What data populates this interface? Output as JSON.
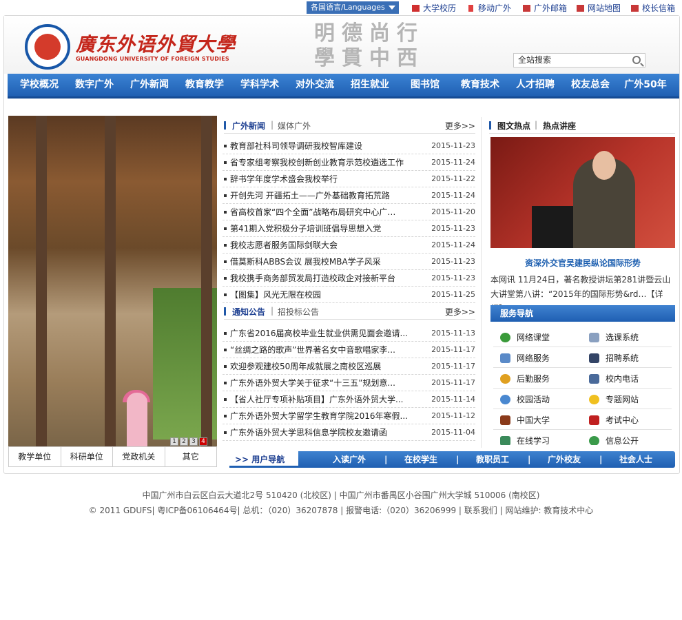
{
  "topbar": {
    "language": "各国语言/Languages",
    "links": [
      "大学校历",
      "移动广外",
      "广外邮箱",
      "网站地图",
      "校长信箱"
    ]
  },
  "header": {
    "cn_name": "廣东外语外貿大學",
    "en_name": "GUANGDONG UNIVERSITY OF FOREIGN STUDIES",
    "motto": "明德尚行 學貫中西",
    "search_value": "全站搜索"
  },
  "nav": [
    "学校概况",
    "数字广外",
    "广外新闻",
    "教育教学",
    "学科学术",
    "对外交流",
    "招生就业",
    "图书馆",
    "教育技术",
    "人才招聘",
    "校友总会",
    "广外50年"
  ],
  "slider": {
    "dots": [
      "1",
      "2",
      "3",
      "4"
    ],
    "active_dot": "4"
  },
  "bottom_tabs": [
    "教学单位",
    "科研单位",
    "党政机关",
    "其它"
  ],
  "news": {
    "tab_active": "广外新闻",
    "tab_other": "媒体广外",
    "more": "更多>>",
    "items": [
      {
        "title": "教育部社科司领导调研我校智库建设",
        "date": "2015-11-23"
      },
      {
        "title": "省专家组考察我校创新创业教育示范校遴选工作",
        "date": "2015-11-24"
      },
      {
        "title": "辞书学年度学术盛会我校举行",
        "date": "2015-11-22"
      },
      {
        "title": "开创先河  开疆拓土——广外基础教育拓荒路",
        "date": "2015-11-24"
      },
      {
        "title": "省高校首家“四个全面”战略布局研究中心广…",
        "date": "2015-11-20"
      },
      {
        "title": "第41期入党积极分子培训班倡导思想入党",
        "date": "2015-11-23"
      },
      {
        "title": "我校志愿者服务国际剑联大会",
        "date": "2015-11-24"
      },
      {
        "title": "借莫斯科ABBS会议 展我校MBA学子风采",
        "date": "2015-11-23"
      },
      {
        "title": "我校携手商务部贸发局打造校政企对接新平台",
        "date": "2015-11-23"
      },
      {
        "title": "【图集】风光无限在校园",
        "date": "2015-11-25"
      }
    ]
  },
  "notices": {
    "tab_active": "通知公告",
    "tab_other": "招投标公告",
    "more": "更多>>",
    "items": [
      {
        "title": "广东省2016届高校毕业生就业供需见面会邀请...",
        "date": "2015-11-13"
      },
      {
        "title": "“丝绸之路的歌声”世界著名女中音歌唱家李...",
        "date": "2015-11-17"
      },
      {
        "title": "欢迎参观建校50周年成就展之南校区巡展",
        "date": "2015-11-17"
      },
      {
        "title": "广东外语外贸大学关于征求“十三五”规划意...",
        "date": "2015-11-17"
      },
      {
        "title": "【省人社厅专项补贴项目】广东外语外贸大学...",
        "date": "2015-11-14"
      },
      {
        "title": "广东外语外贸大学留学生教育学院2016年寒假...",
        "date": "2015-11-12"
      },
      {
        "title": "广东外语外贸大学思科信息学院校友邀请函",
        "date": "2015-11-04"
      }
    ]
  },
  "photo_news": {
    "tab_active": "图文热点",
    "tab_other": "热点讲座",
    "title": "资深外交官吴建民纵论国际形势",
    "desc": "本网讯 11月24日，著名教授讲坛第281讲暨云山大讲堂第八讲：“2015年的国际形势&rd…【详细】"
  },
  "services": {
    "title": "服务导航",
    "items": [
      {
        "label": "网络课堂",
        "icon": "globe-icon"
      },
      {
        "label": "选课系统",
        "icon": "table-icon"
      },
      {
        "label": "网络服务",
        "icon": "network-icon"
      },
      {
        "label": "招聘系统",
        "icon": "recruit-icon"
      },
      {
        "label": "后勤服务",
        "icon": "coin-icon"
      },
      {
        "label": "校内电话",
        "icon": "phone-icon"
      },
      {
        "label": "校园活动",
        "icon": "person-icon"
      },
      {
        "label": "专题网站",
        "icon": "star-icon"
      },
      {
        "label": "中国大学",
        "icon": "book-icon"
      },
      {
        "label": "考试中心",
        "icon": "exam-icon"
      },
      {
        "label": "在线学习",
        "icon": "study-icon"
      },
      {
        "label": "信息公开",
        "icon": "earth-icon"
      }
    ]
  },
  "user_nav": {
    "label": ">> 用户导航",
    "items": [
      "入读广外",
      "在校学生",
      "教职员工",
      "广外校友",
      "社会人士"
    ],
    "sep": "|"
  },
  "footer": {
    "line1": "中国广州市白云区白云大道北2号 510420 (北校区) | 中国广州市番禺区小谷围广州大学城 510006 (南校区)",
    "line2": "© 2011 GDUFS| 粤ICP备06106464号| 总机：（020）36207878 | 报警电话:（020）36206999 | 联系我们 | 网站维护: 教育技术中心"
  },
  "colors": {
    "brand_blue": "#1f5fb2",
    "brand_red": "#c4261b",
    "link_blue": "#1d3f91"
  }
}
